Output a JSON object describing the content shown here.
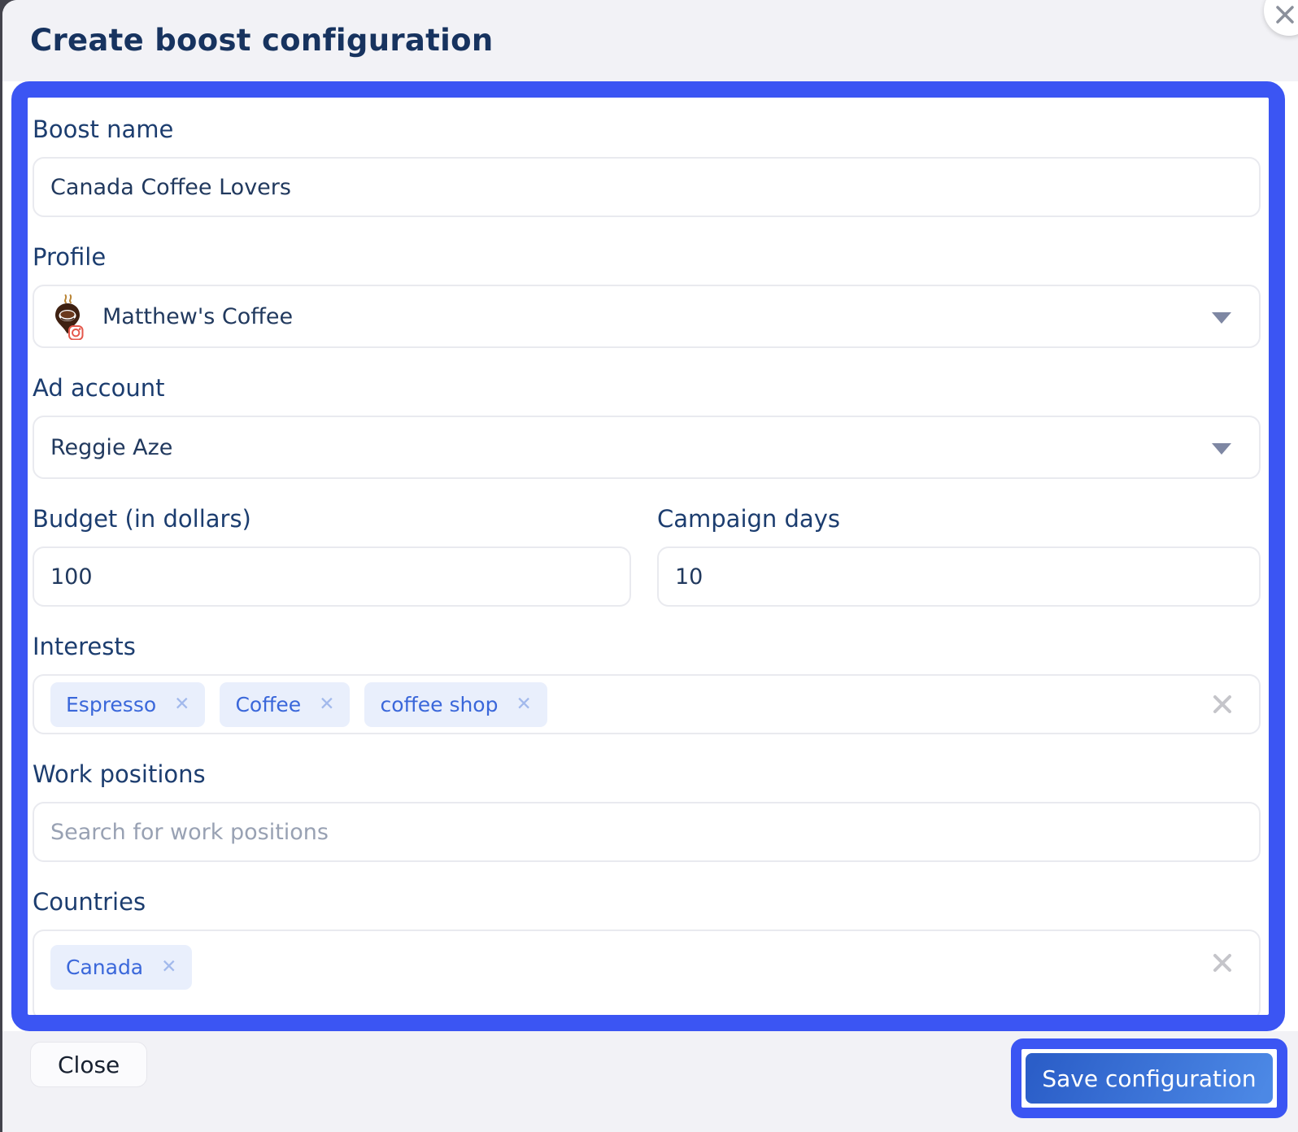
{
  "dialog": {
    "title": "Create boost configuration"
  },
  "form": {
    "boost_name": {
      "label": "Boost name",
      "value": "Canada Coffee Lovers"
    },
    "profile": {
      "label": "Profile",
      "value": "Matthew's Coffee"
    },
    "ad_account": {
      "label": "Ad account",
      "value": "Reggie Aze"
    },
    "budget": {
      "label": "Budget (in dollars)",
      "value": "100"
    },
    "campaign_days": {
      "label": "Campaign days",
      "value": "10"
    },
    "interests": {
      "label": "Interests",
      "tags": [
        "Espresso",
        "Coffee",
        "coffee shop"
      ]
    },
    "work_positions": {
      "label": "Work positions",
      "placeholder": "Search for work positions"
    },
    "countries": {
      "label": "Countries",
      "tags": [
        "Canada"
      ]
    }
  },
  "footer": {
    "close_label": "Close",
    "save_label": "Save configuration"
  },
  "icons": {
    "profile_logo": "coffee-pin-with-instagram-badge",
    "select_caret": "chevron-down-icon",
    "field_clear": "clear-x-icon",
    "tag_remove": "remove-tag-x-icon",
    "dialog_close": "close-x-icon"
  },
  "colors": {
    "annotation_accent": "#3b55f3",
    "title_navy": "#17335f",
    "label_navy": "#1c3d6f",
    "header_footer_bg": "#f2f2f6",
    "save_gradient_start": "#2b5ec8",
    "save_gradient_end": "#4c88e5",
    "tag_bg": "#e9effc",
    "tag_text": "#3a67da"
  }
}
